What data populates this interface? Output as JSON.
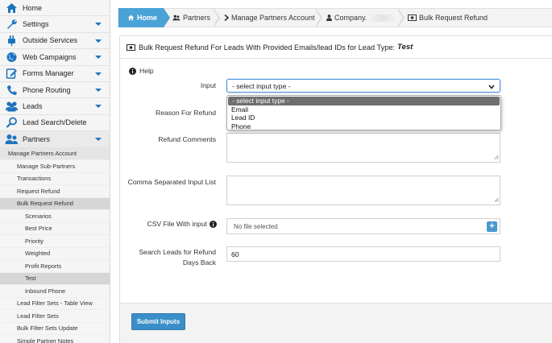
{
  "sidebar": {
    "items": [
      {
        "label": "Home",
        "icon": "home-icon"
      },
      {
        "label": "Settings",
        "icon": "wrench-icon"
      },
      {
        "label": "Outside Services",
        "icon": "plug-icon"
      },
      {
        "label": "Web Campaigns",
        "icon": "globe-icon"
      },
      {
        "label": "Forms Manager",
        "icon": "form-edit-icon"
      },
      {
        "label": "Phone Routing",
        "icon": "phone-icon"
      },
      {
        "label": "Leads",
        "icon": "users-icon"
      },
      {
        "label": "Lead Search/Delete",
        "icon": "search-icon"
      },
      {
        "label": "Partners",
        "icon": "partners-icon"
      }
    ],
    "subs": [
      "Manage Partners Account",
      "Manage Sub-Partners",
      "Transactions",
      "Request Refund",
      "Bulk Request Refund",
      "Scenarios",
      "Best Price",
      "Priority",
      "Weighted",
      "Profit Reports",
      "Test",
      "Inbound Phone",
      "Lead Filter Sets - Table View",
      "Lead Filter Sets",
      "Bulk Filter Sets Update",
      "Simple Partner Notes"
    ]
  },
  "breadcrumb": {
    "home": "Home",
    "partners": "Partners",
    "manage": "Manage Partners Account",
    "company": "Company.",
    "bulk": "Bulk Request Refund"
  },
  "panel": {
    "title": "Bulk Request Refund For Leads With Provided Emails/lead IDs for Lead Type:",
    "lead_type": "Test",
    "help": "Help"
  },
  "form": {
    "input_label": "Input",
    "input_selected": "- select input type -",
    "options": [
      "- select input type -",
      "Email",
      "Lead ID",
      "Phone"
    ],
    "reason_label": "Reason For Refund",
    "comments_label": "Refund Comments",
    "comma_label": "Comma Separated Input List",
    "csv_label": "CSV File With input",
    "csv_value": "No file selected",
    "days_label_1": "Search Leads for Refund",
    "days_label_2": "Days Back",
    "days_value": "60",
    "submit": "Submit Inputs"
  },
  "colors": {
    "accent": "#4aa3d6",
    "submit": "#3a8fc8",
    "icon_blue": "#1e73be"
  }
}
